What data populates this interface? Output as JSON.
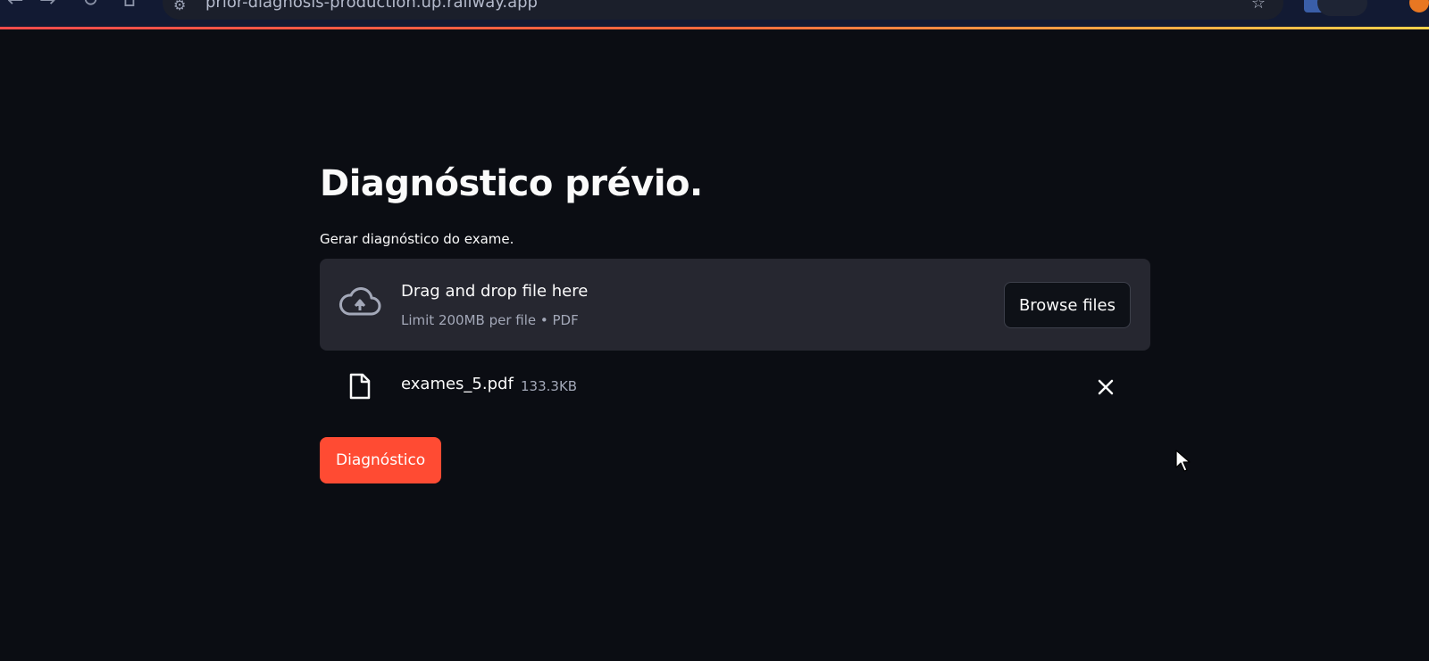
{
  "browser": {
    "url": "prior-diagnosis-production.up.railway.app",
    "back_glyph": "←",
    "forward_glyph": "→",
    "reload_glyph": "↻",
    "home_glyph": "⌂",
    "star_glyph": "☆"
  },
  "page": {
    "title": "Diagnóstico prévio."
  },
  "uploader": {
    "label": "Gerar diagnóstico do exame.",
    "drop_title": "Drag and drop file here",
    "drop_subtitle": "Limit 200MB per file • PDF",
    "browse_label": "Browse files",
    "icon": "cloud-upload-icon"
  },
  "uploaded_file": {
    "name": "exames_5.pdf",
    "size": "133.3KB",
    "icon": "file-icon"
  },
  "actions": {
    "diagnose_label": "Diagnóstico"
  },
  "colors": {
    "background": "#0b0d13",
    "dropzone": "#262730",
    "primary": "#ff4b33",
    "text": "#fafafa",
    "muted_text": "#a3a8b8"
  }
}
